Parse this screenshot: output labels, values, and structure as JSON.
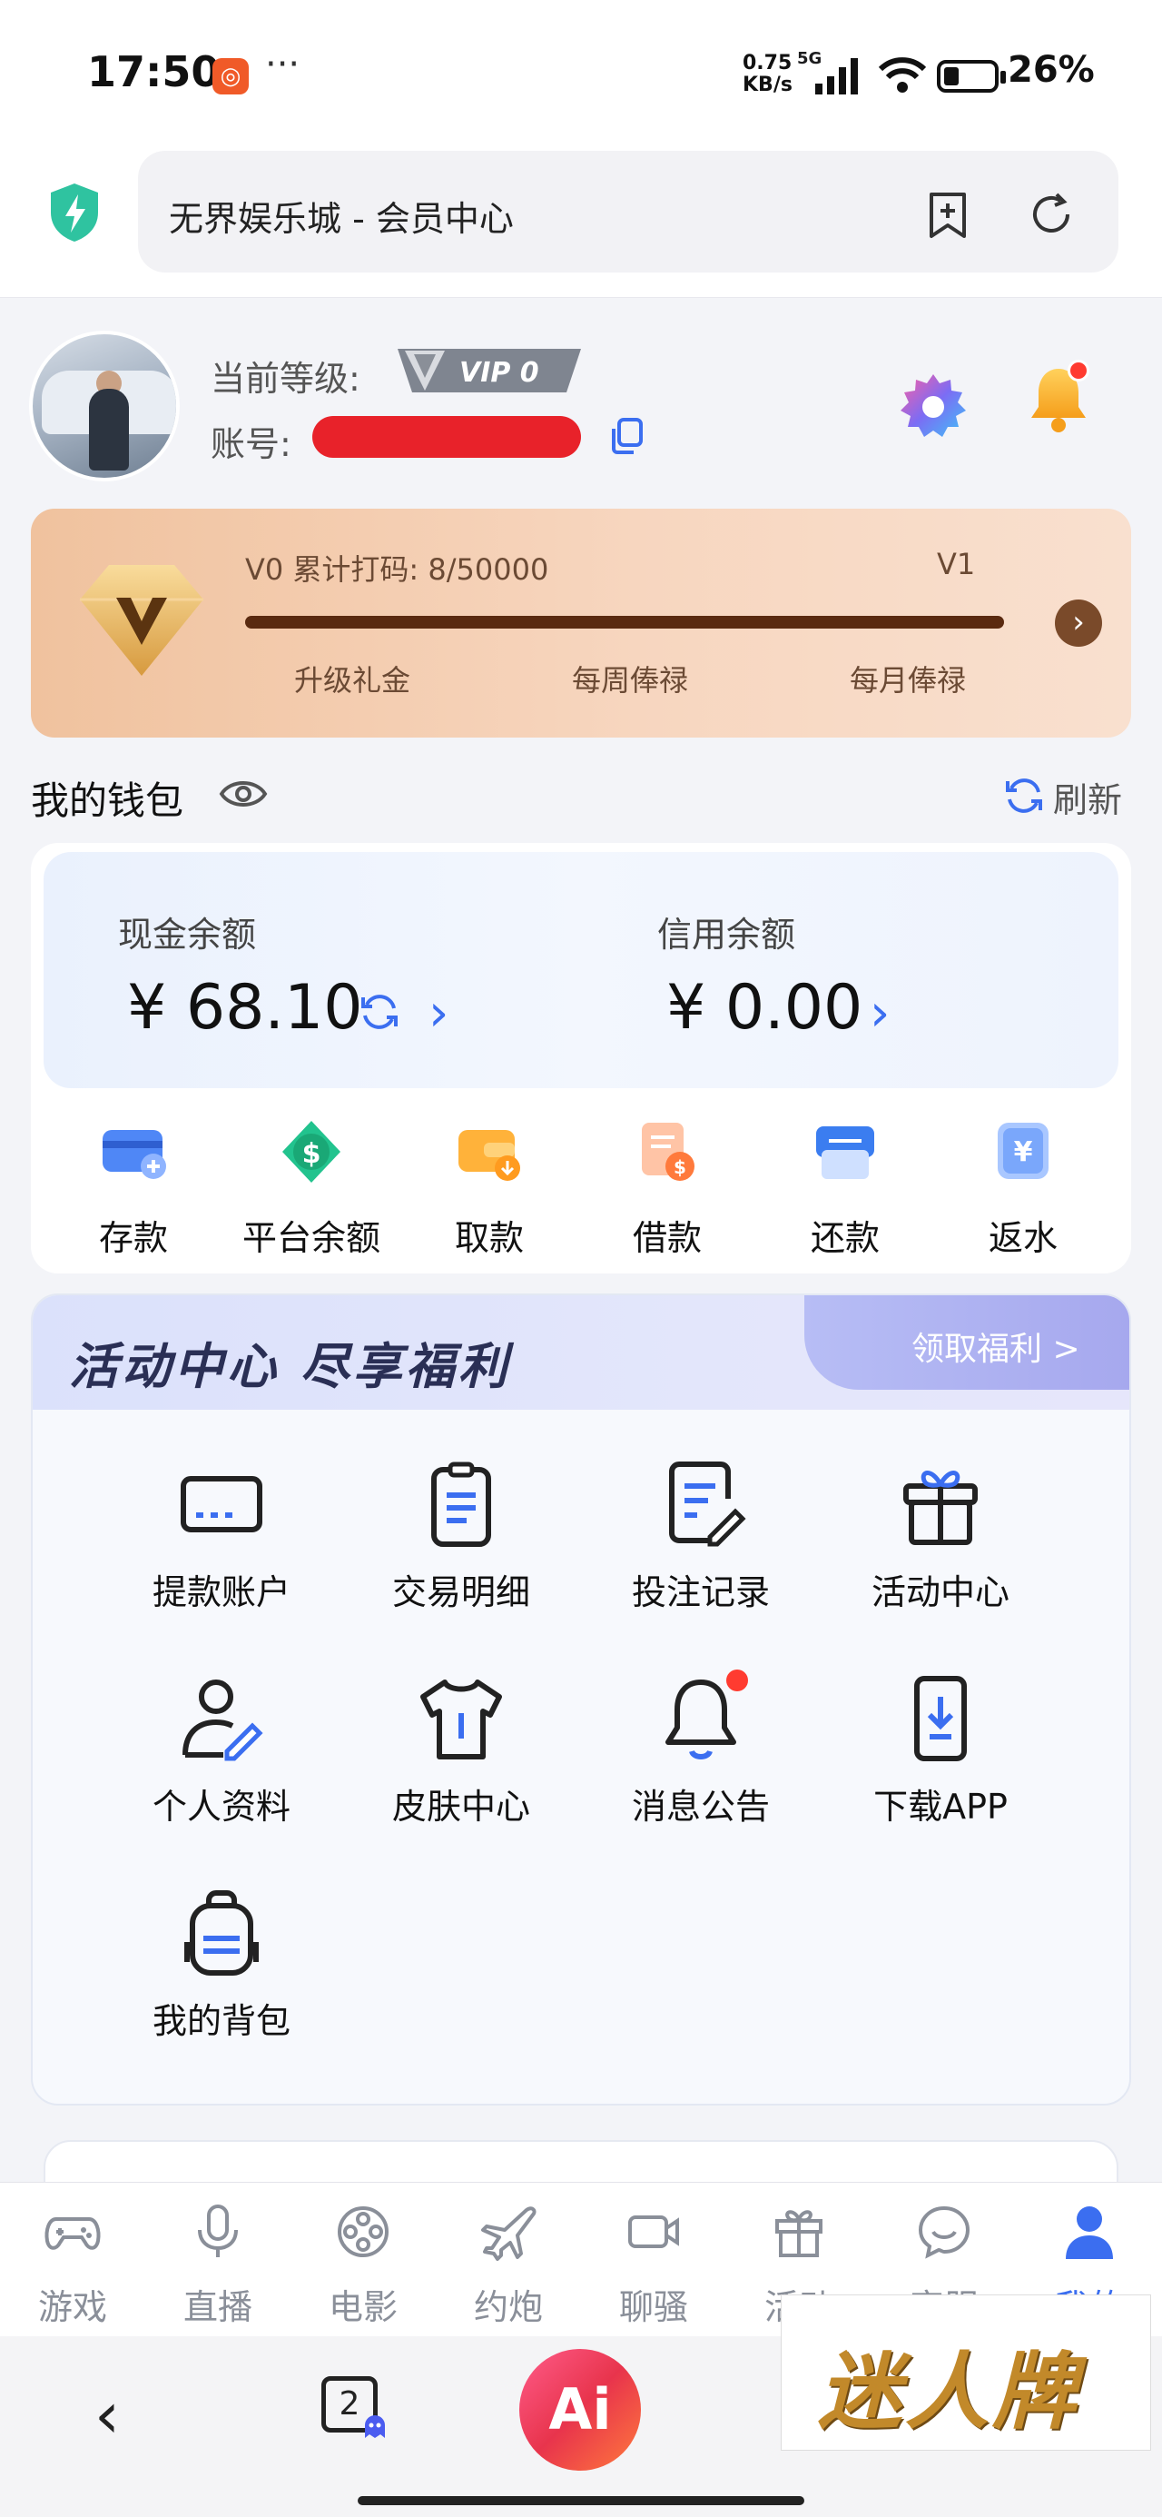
{
  "status_bar": {
    "time": "17:50",
    "net_speed_top": "0.75",
    "net_speed_bottom": "KB/s",
    "network": "5G",
    "battery": "26%",
    "more": "···"
  },
  "browser": {
    "url_title": "无界娱乐城 - 会员中心",
    "tab_count": "2",
    "ai_label": "Ai"
  },
  "profile": {
    "level_label": "当前等级:",
    "vip_badge": "VIP 0",
    "account_label": "账号:"
  },
  "vip_card": {
    "progress_text": "V0 累计打码: 8/50000",
    "next_level": "V1",
    "perks": [
      "升级礼金",
      "每周俸禄",
      "每月俸禄"
    ],
    "progress": 0.00016
  },
  "wallet": {
    "title": "我的钱包",
    "refresh": "刷新",
    "cash_label": "现金余额",
    "cash_value": "¥ 68.10",
    "credit_label": "信用余额",
    "credit_value": "¥ 0.00",
    "actions": [
      "存款",
      "平台余额",
      "取款",
      "借款",
      "还款",
      "返水"
    ]
  },
  "activity": {
    "title": "活动中心 尽享福利",
    "claim": "领取福利 >",
    "items": [
      "提款账户",
      "交易明细",
      "投注记录",
      "活动中心",
      "个人资料",
      "皮肤中心",
      "消息公告",
      "下载APP",
      "我的背包"
    ]
  },
  "tabbar": {
    "items": [
      "游戏",
      "直播",
      "电影",
      "约炮",
      "聊骚",
      "活动",
      "客服",
      "我的"
    ],
    "active": "我的"
  },
  "watermark": "迷人牌",
  "colors": {
    "accent": "#3b6ef0",
    "vip_card": "#f0c29e",
    "badge": "#ff3b30"
  }
}
